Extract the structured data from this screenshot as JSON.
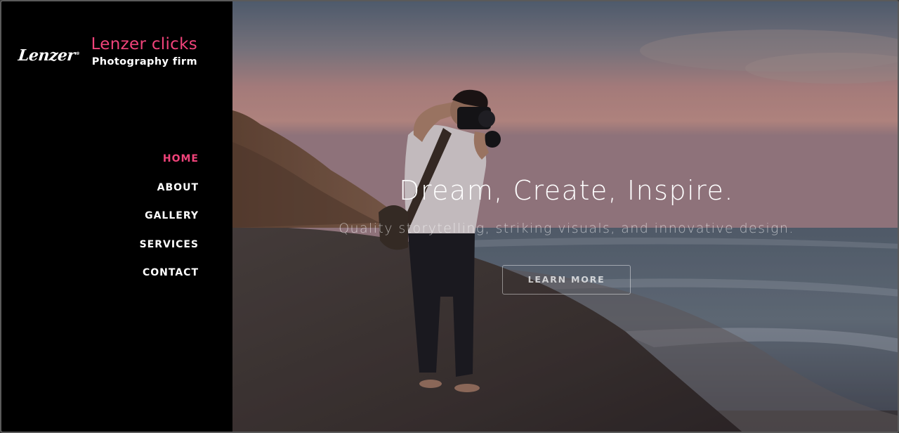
{
  "sidebar": {
    "logo_text": "Lenzer",
    "logo_mark": "®",
    "brand_name": "Lenzer clicks",
    "brand_tagline": "Photography firm",
    "nav": [
      {
        "label": "HOME",
        "active": true
      },
      {
        "label": "ABOUT",
        "active": false
      },
      {
        "label": "GALLERY",
        "active": false
      },
      {
        "label": "SERVICES",
        "active": false
      },
      {
        "label": "CONTACT",
        "active": false
      }
    ]
  },
  "hero": {
    "title": "Dream, Create, Inspire.",
    "subtitle": "Quality storytelling, striking visuals, and innovative design.",
    "cta_label": "LEARN MORE",
    "background_image": "photographer-on-beach-at-sunset"
  },
  "colors": {
    "accent": "#f0437a",
    "sidebar_bg": "#000000",
    "text": "#ffffff"
  }
}
